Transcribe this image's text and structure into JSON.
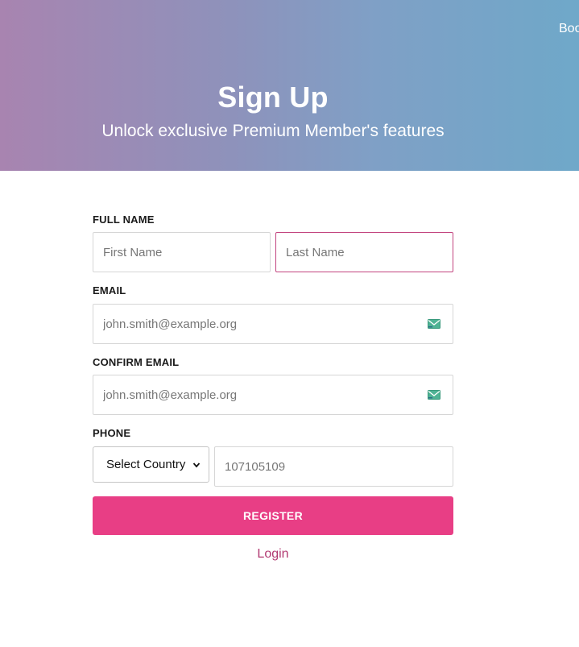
{
  "header": {
    "nav_link": "Boo",
    "title": "Sign Up",
    "subtitle": "Unlock exclusive Premium Member's features"
  },
  "form": {
    "full_name_label": "FULL NAME",
    "first_name_placeholder": "First Name",
    "last_name_placeholder": "Last Name",
    "email_label": "EMAIL",
    "email_placeholder": "john.smith@example.org",
    "confirm_email_label": "CONFIRM EMAIL",
    "confirm_email_placeholder": "john.smith@example.org",
    "phone_label": "PHONE",
    "country_select_value": "Select Country",
    "phone_placeholder": "107105109",
    "register_label": "REGISTER",
    "login_label": "Login"
  },
  "colors": {
    "accent": "#e83e85",
    "link": "#b23a72",
    "focus_border": "#c2447f"
  },
  "icons": {
    "email_field": "envelope-icon",
    "confirm_email_field": "envelope-icon",
    "select_arrow": "chevron-down-icon"
  }
}
